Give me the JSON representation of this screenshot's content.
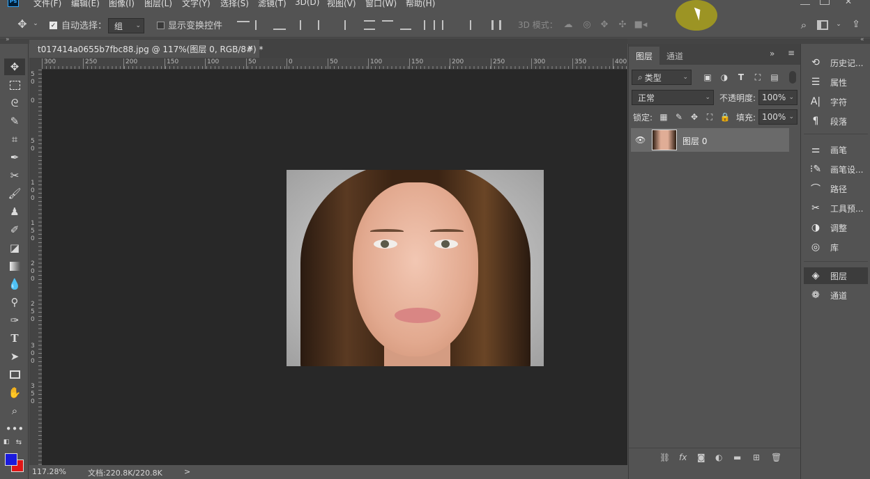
{
  "app": {
    "logo_text": "Ps",
    "menu": [
      "文件(F)",
      "编辑(E)",
      "图像(I)",
      "图层(L)",
      "文字(Y)",
      "选择(S)",
      "滤镜(T)",
      "3D(D)",
      "视图(V)",
      "窗口(W)",
      "帮助(H)"
    ]
  },
  "options": {
    "auto_select_label": "自动选择：",
    "auto_select_checked": true,
    "auto_select_value": "组",
    "show_transform_label": "显示变换控件",
    "show_transform_checked": false,
    "mode_3d_label": "3D 模式："
  },
  "document": {
    "tab_title": "t017414a0655b7fbc88.jpg @ 117%(图层 0, RGB/8#) *",
    "close_glyph": "×"
  },
  "ruler": {
    "h_labels": [
      "300",
      "250",
      "200",
      "150",
      "100",
      "50",
      "0",
      "50",
      "100",
      "150",
      "200",
      "250",
      "300",
      "350",
      "400"
    ],
    "v_labels": [
      "50",
      "0",
      "50",
      "100",
      "150",
      "200",
      "250",
      "300",
      "350"
    ]
  },
  "status": {
    "zoom": "117.28%",
    "doc_info": "文档:220.8K/220.8K",
    "arrow": ">"
  },
  "layers_panel": {
    "tabs": [
      "图层",
      "通道"
    ],
    "filter_label": "类型",
    "blend_mode": "正常",
    "opacity_label": "不透明度:",
    "opacity_value": "100%",
    "lock_label": "锁定:",
    "fill_label": "填充:",
    "fill_value": "100%",
    "layers": [
      {
        "name": "图层 0",
        "visible": true
      }
    ]
  },
  "dock": {
    "items": [
      "历史记...",
      "属性",
      "字符",
      "段落",
      "画笔",
      "画笔设...",
      "路径",
      "工具预...",
      "调整",
      "库",
      "图层",
      "通道"
    ],
    "active": "图层"
  },
  "colors": {
    "foreground": "#1a1adb",
    "background": "#e01515",
    "accent": "#31a8ff"
  }
}
